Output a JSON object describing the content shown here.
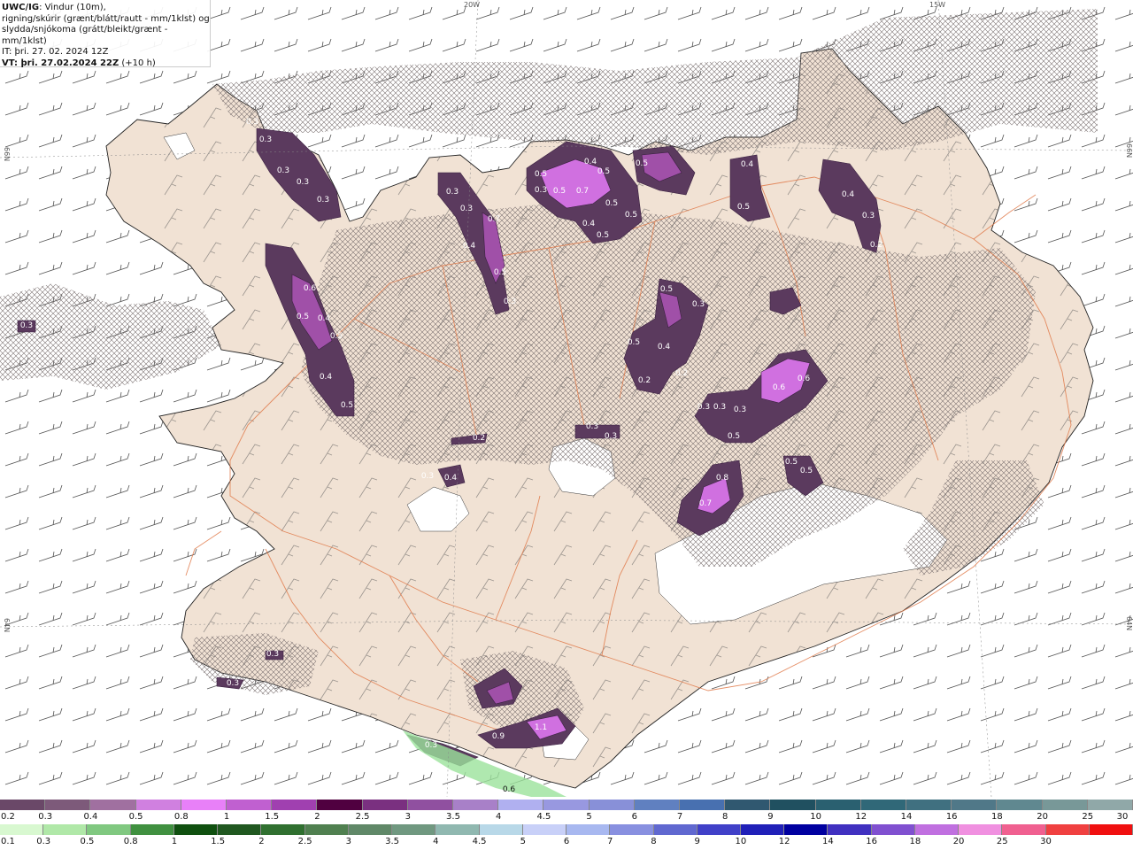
{
  "info": {
    "product": "UWC/IG",
    "line1_rest": ": Vindur (10m),",
    "line2": "rigning/skúrir (grænt/blátt/rautt - mm/1klst) og",
    "line3": "slydda/snjókoma (grátt/bleikt/grænt - mm/1klst)",
    "it_line": "IT: þri. 27. 02. 2024 12Z",
    "vt_label": "VT",
    "vt_rest": ": þri. 27.02.2024 22Z",
    "vt_offset": " (+10 h)"
  },
  "grid_labels": {
    "lon_20w": "20W",
    "lon_15w": "15W",
    "lat_66n_left": "66N",
    "lat_66n_right": "66N",
    "lat_64n_left": "64N",
    "lat_64n_right": "64N"
  },
  "colors": {
    "land": "#f1e2d4",
    "sea": "#ffffff",
    "roads": "#e07a4a",
    "hatch": "#8a7f7f",
    "snow_dark": "#5b3a5e",
    "snow_mid": "#a050a8",
    "snow_light": "#e070e8",
    "rain_green": "#9be29b"
  },
  "precip_values": [
    {
      "v": "0.3"
    },
    {
      "v": "0.3"
    },
    {
      "v": "0.3"
    },
    {
      "v": "0.3"
    },
    {
      "v": "0.3"
    },
    {
      "v": "0.6"
    },
    {
      "v": "0.5"
    },
    {
      "v": "0.4"
    },
    {
      "v": "0.5"
    },
    {
      "v": "0.4"
    },
    {
      "v": "0.5"
    },
    {
      "v": "0.3"
    },
    {
      "v": "0.3"
    },
    {
      "v": "0.4"
    },
    {
      "v": "0.7"
    },
    {
      "v": "0.5"
    },
    {
      "v": "0.3"
    },
    {
      "v": "0.3"
    },
    {
      "v": "0.5"
    },
    {
      "v": "0.5"
    },
    {
      "v": "0.7"
    },
    {
      "v": "0.4"
    },
    {
      "v": "0.5"
    },
    {
      "v": "0.5"
    },
    {
      "v": "0.5"
    },
    {
      "v": "0.4"
    },
    {
      "v": "0.5"
    },
    {
      "v": "0.5"
    },
    {
      "v": "0.4"
    },
    {
      "v": "0.5"
    },
    {
      "v": "0.4"
    },
    {
      "v": "0.3"
    },
    {
      "v": "0.2"
    },
    {
      "v": "0.5"
    },
    {
      "v": "0.3"
    },
    {
      "v": "0.5"
    },
    {
      "v": "0.4"
    },
    {
      "v": "0.2"
    },
    {
      "v": "0.2"
    },
    {
      "v": "0.3"
    },
    {
      "v": "0.6"
    },
    {
      "v": "0.6"
    },
    {
      "v": "0.3"
    },
    {
      "v": "0.3"
    },
    {
      "v": "0.5"
    },
    {
      "v": "0.8"
    },
    {
      "v": "0.7"
    },
    {
      "v": "0.5"
    },
    {
      "v": "0.5"
    },
    {
      "v": "0.3"
    },
    {
      "v": "0.4"
    },
    {
      "v": "0.2"
    },
    {
      "v": "0.3"
    },
    {
      "v": "0.3"
    },
    {
      "v": "0.3"
    },
    {
      "v": "0.3"
    },
    {
      "v": "0.9"
    },
    {
      "v": "1.1"
    },
    {
      "v": "0.3"
    },
    {
      "v": "0.6"
    },
    {
      "v": "0.3"
    }
  ],
  "snow_scale": {
    "colors": [
      "#6a4868",
      "#7d5a7a",
      "#a070a0",
      "#d080e0",
      "#e880f8",
      "#c060d0",
      "#a040b0",
      "#500040",
      "#7a3080",
      "#9050a0",
      "#a880c8",
      "#b0b0f0",
      "#9898e0",
      "#8890d8",
      "#6080c0",
      "#4870b0",
      "#305870",
      "#205060",
      "#2a6070",
      "#306878",
      "#407080",
      "#507888",
      "#608890",
      "#789898",
      "#90a8a8"
    ],
    "labels": [
      "0.2",
      "0.3",
      "0.4",
      "0.5",
      "0.8",
      "1",
      "1.5",
      "2",
      "2.5",
      "3",
      "3.5",
      "4",
      "4.5",
      "5",
      "6",
      "7",
      "8",
      "9",
      "10",
      "12",
      "14",
      "16",
      "18",
      "20",
      "25",
      "30"
    ]
  },
  "rain_scale": {
    "colors": [
      "#d8f8d0",
      "#b0e8a8",
      "#80c880",
      "#409040",
      "#105010",
      "#205820",
      "#307030",
      "#508050",
      "#608868",
      "#709880",
      "#90b8b0",
      "#b8d8e8",
      "#c8d0f8",
      "#a8b8f0",
      "#8890e0",
      "#6068d0",
      "#4040c8",
      "#2020b8",
      "#0000a0",
      "#4030c0",
      "#8050d0",
      "#c070e0",
      "#f090e0",
      "#f06090",
      "#f04040",
      "#f01010"
    ],
    "labels": [
      "0.1",
      "0.3",
      "0.5",
      "0.8",
      "1",
      "1.5",
      "2",
      "2.5",
      "3",
      "3.5",
      "4",
      "4.5",
      "5",
      "6",
      "7",
      "8",
      "9",
      "10",
      "12",
      "14",
      "16",
      "18",
      "20",
      "25",
      "30"
    ]
  }
}
